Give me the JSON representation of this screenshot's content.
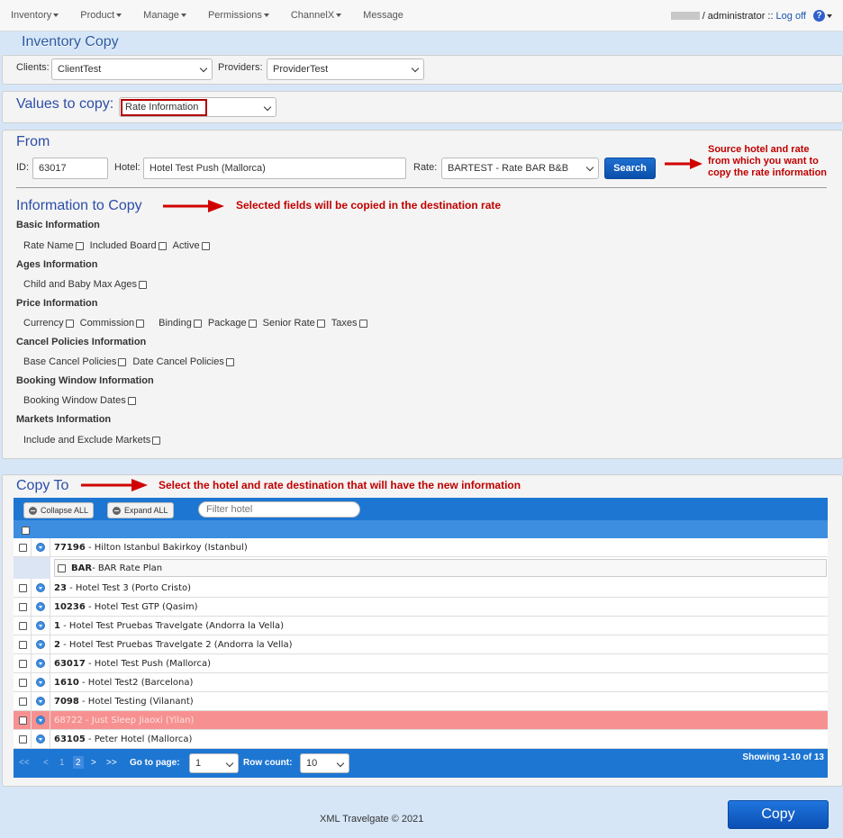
{
  "nav": {
    "menu": [
      {
        "label": "Inventory"
      },
      {
        "label": "Product"
      },
      {
        "label": "Manage"
      },
      {
        "label": "Permissions"
      },
      {
        "label": "ChannelX"
      },
      {
        "label": "Message"
      }
    ],
    "user": "/ administrator ::",
    "logoff": "Log off",
    "help_icon": "?"
  },
  "page_title": "Inventory Copy",
  "clients": {
    "label": "Clients:",
    "value": "ClientTest"
  },
  "providers": {
    "label": "Providers:",
    "value": "ProviderTest"
  },
  "values_to_copy": {
    "label": "Values to copy:",
    "value": "Rate Information"
  },
  "from": {
    "title": "From",
    "id_label": "ID:",
    "id_value": "63017",
    "hotel_label": "Hotel:",
    "hotel_value": "Hotel Test Push (Mallorca)",
    "rate_label": "Rate:",
    "rate_value": "BARTEST - Rate BAR B&B",
    "search_label": "Search",
    "annotation_lines": [
      "Source hotel and rate",
      "from which you want to",
      "copy the rate information"
    ]
  },
  "info": {
    "title": "Information to Copy",
    "annotation": "Selected fields will be copied in the destination rate",
    "groups": [
      {
        "heading": "Basic Information",
        "options": [
          "Rate Name",
          "Included Board",
          "Active"
        ]
      },
      {
        "heading": "Ages Information",
        "options": [
          "Child and Baby Max Ages"
        ]
      },
      {
        "heading": "Price Information",
        "options": [
          "Currency",
          "Commission",
          "Binding",
          "Package",
          "Senior Rate",
          "Taxes"
        ]
      },
      {
        "heading": "Cancel Policies Information",
        "options": [
          "Base Cancel Policies",
          "Date Cancel Policies"
        ]
      },
      {
        "heading": "Booking Window Information",
        "options": [
          "Booking Window Dates"
        ]
      },
      {
        "heading": "Markets Information",
        "options": [
          "Include and Exclude Markets"
        ]
      }
    ]
  },
  "copy_to": {
    "title": "Copy To",
    "annotation": "Select the hotel and rate destination that will have the new information",
    "collapse_all": "Collapse ALL",
    "expand_all": "Expand ALL",
    "filter_placeholder": "Filter hotel",
    "sub_rate": {
      "code": "BAR",
      "name": " - BAR Rate Plan"
    },
    "rows": [
      {
        "code": "77196",
        "name": " - Hilton Istanbul Bakirkoy (Istanbul)"
      },
      {
        "code": "23",
        "name": " - Hotel Test 3 (Porto Cristo)"
      },
      {
        "code": "10236",
        "name": " - Hotel Test GTP (Qasim)"
      },
      {
        "code": "1",
        "name": " - Hotel Test Pruebas Travelgate (Andorra la Vella)"
      },
      {
        "code": "2",
        "name": " - Hotel Test Pruebas Travelgate 2 (Andorra la Vella)"
      },
      {
        "code": "63017",
        "name": " - Hotel Test Push (Mallorca)"
      },
      {
        "code": "1610",
        "name": " - Hotel Test2 (Barcelona)"
      },
      {
        "code": "7098",
        "name": " - Hotel Testing (Vilanant)"
      },
      {
        "code": "68722",
        "name": " - Just Sleep Jiaoxi (Yilan)"
      },
      {
        "code": "63105",
        "name": " - Peter Hotel (Mallorca)"
      }
    ],
    "pager": {
      "first": "<<",
      "prev": "<",
      "page1": "1",
      "page2": "2",
      "next": ">",
      "last": ">>",
      "go_to_page_label": "Go to page:",
      "go_to_page_value": "1",
      "row_count_label": "Row count:",
      "row_count_value": "10",
      "showing": "Showing 1-10 of 13"
    }
  },
  "footer": "XML Travelgate © 2021",
  "copy_button": "Copy",
  "colors": {
    "accent": "#1d76d2",
    "annotation": "#c00000",
    "highlight_row": "#f79191"
  }
}
